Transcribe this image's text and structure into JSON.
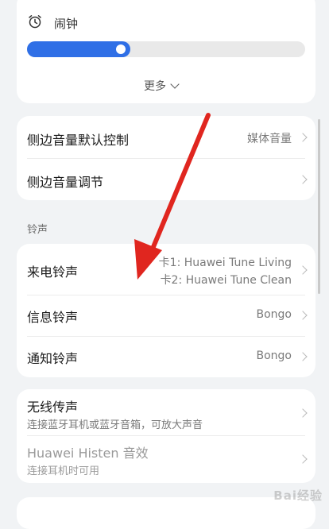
{
  "alarm": {
    "label": "闹钟",
    "volume_fraction": 0.37,
    "more_label": "更多"
  },
  "volume_controls": {
    "items": [
      {
        "title": "侧边音量默认控制",
        "value": "媒体音量"
      },
      {
        "title": "侧边音量调节",
        "value": ""
      }
    ]
  },
  "ringtone_section": {
    "header": "铃声",
    "items": [
      {
        "title": "来电铃声",
        "value_line1": "卡1: Huawei Tune Living",
        "value_line2": "卡2: Huawei Tune Clean"
      },
      {
        "title": "信息铃声",
        "value": "Bongo"
      },
      {
        "title": "通知铃声",
        "value": "Bongo"
      }
    ]
  },
  "wireless": {
    "items": [
      {
        "title": "无线传声",
        "subtitle": "连接蓝牙耳机或蓝牙音箱，可放大声音"
      },
      {
        "title": "Huawei Histen 音效",
        "subtitle": "连接耳机时可用"
      }
    ]
  },
  "colors": {
    "accent": "#2f6fe6",
    "annotation_arrow": "#e0261f",
    "background": "#f1f3f5"
  },
  "watermark": "Bai经验"
}
